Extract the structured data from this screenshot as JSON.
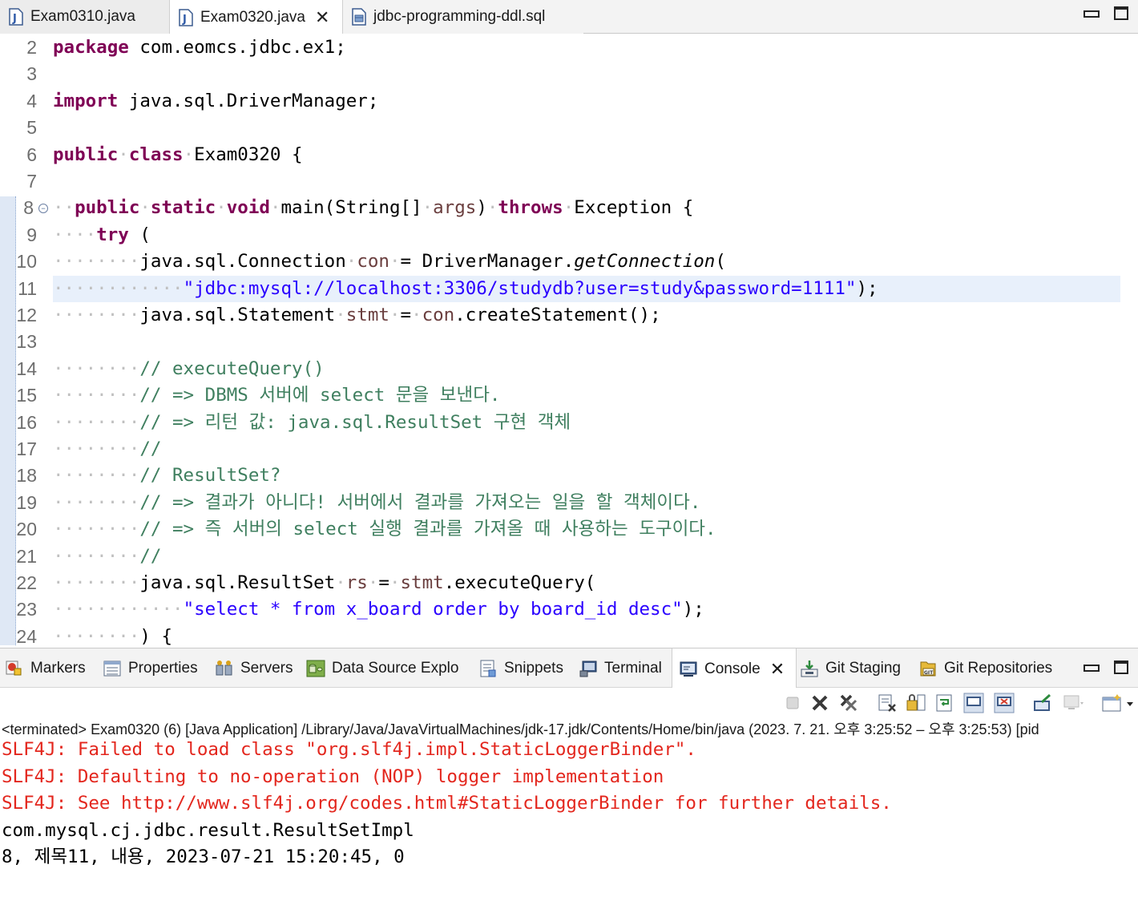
{
  "editor_tabs": [
    {
      "label": "Exam0310.java",
      "icon": "java-file-icon",
      "active": false
    },
    {
      "label": "Exam0320.java",
      "icon": "java-file-icon",
      "active": true
    },
    {
      "label": "jdbc-programming-ddl.sql",
      "icon": "sql-file-icon",
      "active": false
    }
  ],
  "code_lines": [
    {
      "num": "2"
    },
    {
      "num": "3"
    },
    {
      "num": "4"
    },
    {
      "num": "5"
    },
    {
      "num": "6"
    },
    {
      "num": "7"
    },
    {
      "num": "8"
    },
    {
      "num": "9"
    },
    {
      "num": "10"
    },
    {
      "num": "11"
    },
    {
      "num": "12"
    },
    {
      "num": "13"
    },
    {
      "num": "14"
    },
    {
      "num": "15"
    },
    {
      "num": "16"
    },
    {
      "num": "17"
    },
    {
      "num": "18"
    },
    {
      "num": "19"
    },
    {
      "num": "20"
    },
    {
      "num": "21"
    },
    {
      "num": "22"
    },
    {
      "num": "23"
    },
    {
      "num": "24"
    }
  ],
  "code": {
    "l2_kw": "package",
    "l2_rest": " com.eomcs.jdbc.ex1;",
    "l4_kw": "import",
    "l4_rest": " java.sql.DriverManager;",
    "l6_kw1": "public",
    "l6_kw2": "class",
    "l6_rest": "Exam0320 {",
    "l8_kw1": "public",
    "l8_kw2": "static",
    "l8_kw3": "void",
    "l8_a": "main(String[]",
    "l8_arg": "args",
    "l8_b": ")",
    "l8_kw4": "throws",
    "l8_c": "Exception {",
    "l9_kw": "try",
    "l9_rest": " (",
    "l10_a": "java.sql.Connection",
    "l10_var": "con",
    "l10_b": "= DriverManager.",
    "l10_m": "getConnection",
    "l10_c": "(",
    "l11_str": "\"jdbc:mysql://localhost:3306/studydb?user=study&password=1111\"",
    "l11_rest": ");",
    "l12_a": "java.sql.Statement",
    "l12_var": "stmt",
    "l12_b": "=",
    "l12_fld": "con",
    "l12_c": ".createStatement();",
    "l14": "// executeQuery()",
    "l15": "// => DBMS 서버에 select 문을 보낸다.",
    "l16": "// => 리턴 값: java.sql.ResultSet 구현 객체",
    "l17": "//",
    "l18": "// ResultSet?",
    "l19": "// => 결과가 아니다! 서버에서 결과를 가져오는 일을 할 객체이다.",
    "l20": "// => 즉 서버의 select 실행 결과를 가져올 때 사용하는 도구이다.",
    "l21": "//",
    "l22_a": "java.sql.ResultSet",
    "l22_var": "rs",
    "l22_b": "=",
    "l22_fld": "stmt",
    "l22_c": ".executeQuery(",
    "l23_str": "\"select * from x_board order by board_id desc\"",
    "l23_rest": ");",
    "l24": ") {"
  },
  "view_tabs": [
    {
      "label": "Markers",
      "icon": "markers-icon"
    },
    {
      "label": "Properties",
      "icon": "properties-icon"
    },
    {
      "label": "Servers",
      "icon": "servers-icon"
    },
    {
      "label": "Data Source Explo",
      "icon": "data-source-icon"
    },
    {
      "label": "Snippets",
      "icon": "snippets-icon"
    },
    {
      "label": "Terminal",
      "icon": "terminal-icon"
    },
    {
      "label": "Console",
      "icon": "console-icon",
      "active": true
    },
    {
      "label": "Git Staging",
      "icon": "git-staging-icon"
    },
    {
      "label": "Git Repositories",
      "icon": "git-repositories-icon"
    }
  ],
  "console": {
    "status": "<terminated> Exam0320 (6) [Java Application] /Library/Java/JavaVirtualMachines/jdk-17.jdk/Contents/Home/bin/java  (2023. 7. 21. 오후 3:25:52 – 오후 3:25:53) [pid",
    "lines": [
      {
        "text": "SLF4J: Failed to load class \"org.slf4j.impl.StaticLoggerBinder\".",
        "kind": "err"
      },
      {
        "text": "SLF4J: Defaulting to no-operation (NOP) logger implementation",
        "kind": "err"
      },
      {
        "text": "SLF4J: See http://www.slf4j.org/codes.html#StaticLoggerBinder for further details.",
        "kind": "err"
      },
      {
        "text": "com.mysql.cj.jdbc.result.ResultSetImpl",
        "kind": "out"
      },
      {
        "text": "8, 제목11, 내용, 2023-07-21 15:20:45, 0",
        "kind": "out"
      }
    ]
  },
  "colors": {
    "keyword": "#7f0055",
    "string": "#2a00ff",
    "comment": "#3f7f5f",
    "field": "#6a3e3e",
    "stderr": "#e3261d",
    "current_line": "#e8f0fb"
  }
}
